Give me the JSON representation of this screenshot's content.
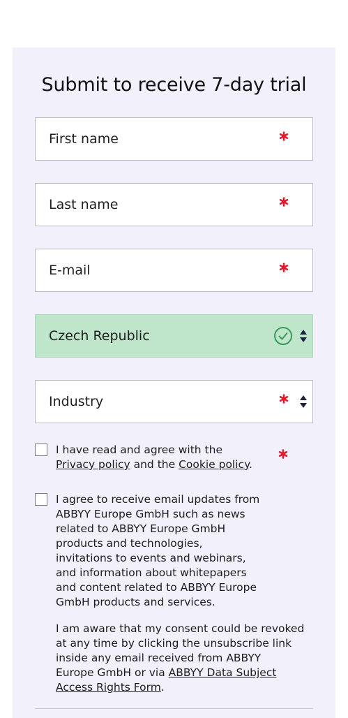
{
  "form": {
    "title": "Submit to receive 7-day trial",
    "fields": {
      "first_name": {
        "label": "First name",
        "required": true
      },
      "last_name": {
        "label": "Last name",
        "required": true
      },
      "email": {
        "label": "E-mail",
        "required": true
      },
      "country": {
        "value": "Czech Republic",
        "status": "valid"
      },
      "industry": {
        "label": "Industry",
        "required": true
      }
    },
    "required_marker": "*",
    "colors": {
      "required": "#e3192b",
      "valid_background": "#bfe6cb",
      "valid_icon": "#3a9a5a",
      "panel_background": "#f2f1fb"
    }
  },
  "consent": {
    "privacy": {
      "text_before": "I have read and agree with the",
      "privacy_link": "Privacy policy",
      "middle": " and the ",
      "cookie_link": "Cookie policy",
      "end": "."
    },
    "marketing": {
      "line1": "I agree to receive email updates from",
      "line2": "ABBYY Europe GmbH such as news",
      "line3": "related to ABBYY Europe GmbH",
      "line4": "products and technologies,",
      "line5": "invitations to events and webinars,",
      "line6": "and information about whitepapers",
      "line7": "and content related to ABBYY Europe",
      "line8": "GmbH products and services.",
      "revoke1": "I am aware that my consent could be revoked",
      "revoke2": "at any time by clicking the unsubscribe link",
      "revoke3": "inside any email received from ABBYY",
      "revoke4_before": "Europe GmbH or via ",
      "revoke4_link": "ABBYY Data Subject",
      "revoke5_link": "Access Rights Form",
      "revoke5_end": "."
    }
  },
  "icons": {
    "required": "asterisk-icon",
    "valid": "check-circle-icon",
    "select": "select-arrows-icon"
  }
}
